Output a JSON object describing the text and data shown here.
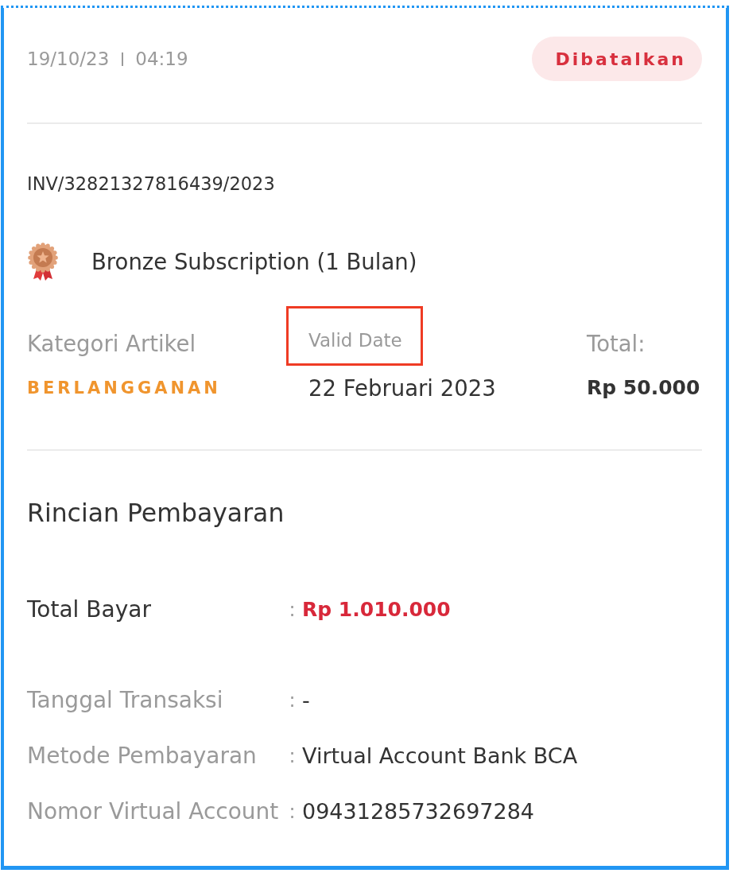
{
  "transaction": {
    "date": "19/10/23",
    "time": "04:19",
    "status": {
      "label": "Dibatalkan",
      "kind": "cancelled"
    },
    "invoice": "INV/32821327816439/2023",
    "product": "Bronze Subscription (1 Bulan)"
  },
  "summary": [
    {
      "label": "Kategori Artikel",
      "value": "BERLANGGANAN",
      "kind": "category",
      "highlighted": false
    },
    {
      "label": "Valid Date",
      "value": "22 Februari 2023",
      "kind": "text",
      "highlighted": true
    },
    {
      "label": "Total:",
      "value": "Rp 50.000",
      "kind": "amount",
      "highlighted": false
    }
  ],
  "payment": {
    "title": "Rincian Pembayaran",
    "rows": [
      {
        "label": "Total Bayar",
        "separator": ":",
        "value": "Rp 1.010.000",
        "kind": "total"
      },
      {
        "label": "Tanggal Transaksi",
        "separator": ":",
        "value": "-",
        "kind": "detail"
      },
      {
        "label": "Metode Pembayaran",
        "separator": ":",
        "value": "Virtual Account Bank BCA",
        "kind": "detail"
      },
      {
        "label": "Nomor Virtual Account",
        "separator": ":",
        "value": "09431285732697284",
        "kind": "detail"
      }
    ]
  }
}
